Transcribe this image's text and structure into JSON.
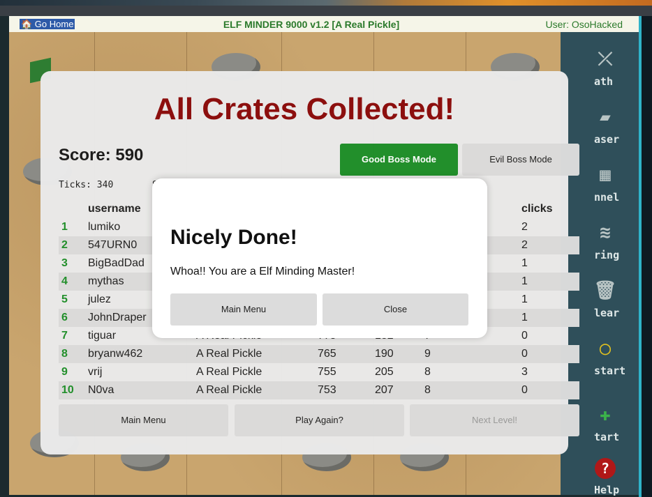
{
  "header": {
    "go_home": "🏠 Go Home",
    "title": "ELF MINDER 9000 v1.2 [A Real Pickle]",
    "user": "User: OsoHacked"
  },
  "sidebar": {
    "tools": [
      {
        "icon": "path-icon",
        "label": "ath"
      },
      {
        "icon": "eraser-icon",
        "label": "aser"
      },
      {
        "icon": "tunnel-icon",
        "label": "nnel"
      },
      {
        "icon": "spring-icon",
        "label": "ring"
      },
      {
        "icon": "trash-icon",
        "label": "lear"
      },
      {
        "icon": "restart-icon",
        "label": "start"
      },
      {
        "icon": "start-icon",
        "label": "tart"
      },
      {
        "icon": "help-icon",
        "label": "Help"
      }
    ]
  },
  "results": {
    "title": "All Crates Collected!",
    "score": "Score: 590",
    "good_boss": "Good Boss Mode",
    "evil_boss": "Evil Boss Mode",
    "ticks": "Ticks: 340",
    "ticks_second": "S",
    "columns": [
      "",
      "username",
      "",
      "",
      "",
      "",
      "clicks"
    ],
    "rows": [
      {
        "rank": "1",
        "username": "lumiko",
        "level": "",
        "score": "",
        "ticks": "",
        "elves": "",
        "clicks": "2"
      },
      {
        "rank": "2",
        "username": "547URN0",
        "level": "",
        "score": "",
        "ticks": "",
        "elves": "",
        "clicks": "2"
      },
      {
        "rank": "3",
        "username": "BigBadDad",
        "level": "",
        "score": "",
        "ticks": "",
        "elves": "",
        "clicks": "1"
      },
      {
        "rank": "4",
        "username": "mythas",
        "level": "",
        "score": "",
        "ticks": "",
        "elves": "",
        "clicks": "1"
      },
      {
        "rank": "5",
        "username": "julez",
        "level": "",
        "score": "",
        "ticks": "",
        "elves": "",
        "clicks": "1"
      },
      {
        "rank": "6",
        "username": "JohnDraper",
        "level": "",
        "score": "",
        "ticks": "",
        "elves": "",
        "clicks": "1"
      },
      {
        "rank": "7",
        "username": "tiguar",
        "level": "A Real Pickle",
        "score": "775",
        "ticks": "182",
        "elves": "7",
        "clicks": "0"
      },
      {
        "rank": "8",
        "username": "bryanw462",
        "level": "A Real Pickle",
        "score": "765",
        "ticks": "190",
        "elves": "9",
        "clicks": "0"
      },
      {
        "rank": "9",
        "username": "vrij",
        "level": "A Real Pickle",
        "score": "755",
        "ticks": "205",
        "elves": "8",
        "clicks": "3"
      },
      {
        "rank": "10",
        "username": "N0va",
        "level": "A Real Pickle",
        "score": "753",
        "ticks": "207",
        "elves": "8",
        "clicks": "0"
      }
    ],
    "main_menu": "Main Menu",
    "play_again": "Play Again?",
    "next_level": "Next Level!"
  },
  "modal": {
    "title": "Nicely Done!",
    "text": "Whoa!! You are a Elf Minding Master!",
    "main_menu": "Main Menu",
    "close": "Close"
  }
}
